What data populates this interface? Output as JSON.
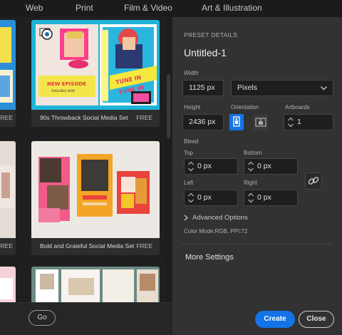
{
  "tabs": [
    "Web",
    "Print",
    "Film & Video",
    "Art & Illustration"
  ],
  "gallery": {
    "cards": [
      {
        "title": "90s Throwback Social Media Set",
        "badge": "FREE"
      },
      {
        "title": "Bold and Grateful Social Media Set",
        "badge": "FREE"
      }
    ],
    "left_badges": [
      "FREE",
      "FREE"
    ],
    "thumb1_texts": {
      "tune_in": "TUNE IN",
      "new_episode": "NEW EPISODE",
      "available": "AVAILABLE NOW"
    },
    "go_label": "Go"
  },
  "preset": {
    "header": "PRESET DETAILS",
    "name": "Untitled-1",
    "width_label": "Width",
    "width_value": "1125 px",
    "units": "Pixels",
    "height_label": "Height",
    "height_value": "2436 px",
    "orientation_label": "Orientation",
    "artboards_label": "Artboards",
    "artboards_value": "1",
    "bleed_label": "Bleed",
    "top_label": "Top",
    "top_value": "0 px",
    "bottom_label": "Bottom",
    "bottom_value": "0 px",
    "left_label": "Left",
    "left_value": "0 px",
    "right_label": "Right",
    "right_value": "0 px",
    "advanced": "Advanced Options",
    "color_mode": "Color Mode:RGB, PPI:72",
    "more_settings": "More Settings"
  },
  "actions": {
    "create": "Create",
    "close": "Close"
  },
  "colors": {
    "accent": "#1473e6",
    "panel": "#323232"
  },
  "icons": [
    "chevron-down-icon",
    "portrait-icon",
    "landscape-icon",
    "link-icon",
    "chevron-right-icon",
    "stepper-icon"
  ]
}
